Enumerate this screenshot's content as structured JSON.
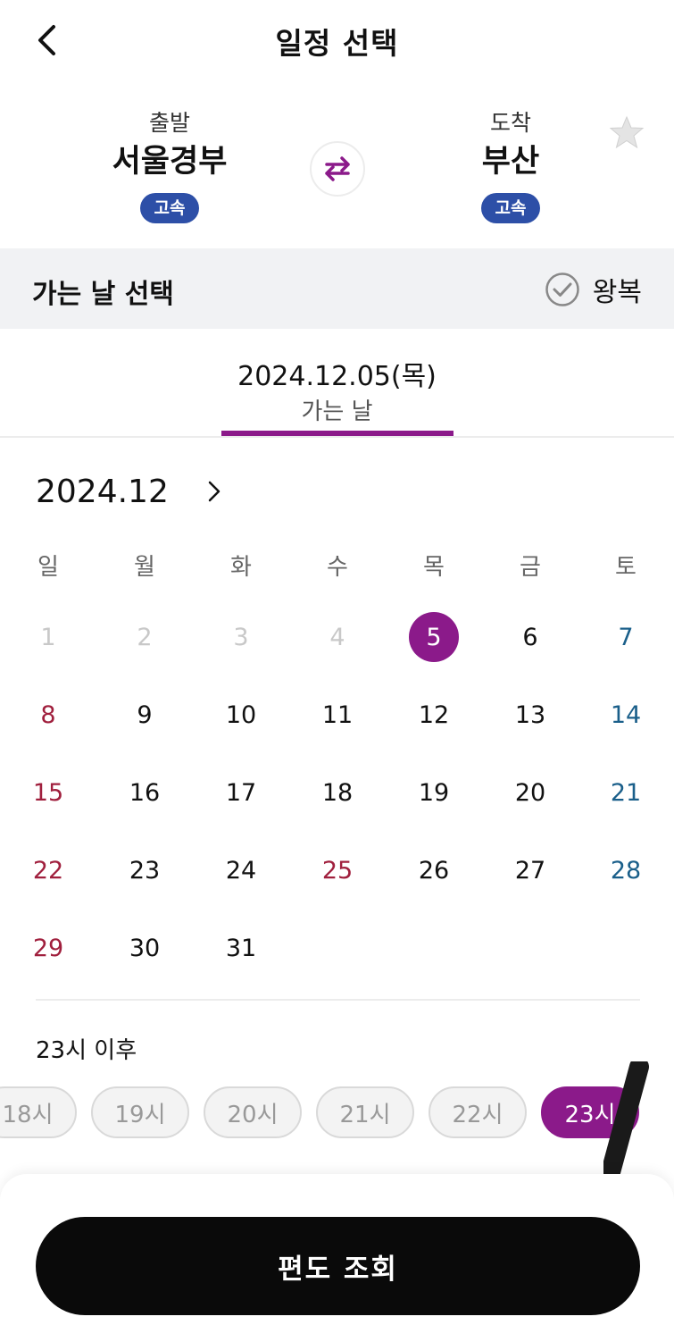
{
  "header": {
    "title": "일정 선택",
    "back_icon": "chevron-left-icon"
  },
  "route": {
    "departure": {
      "label": "출발",
      "name": "서울경부",
      "badge": "고속"
    },
    "arrival": {
      "label": "도착",
      "name": "부산",
      "badge": "고속"
    },
    "swap_icon": "swap-arrows-icon",
    "favorite_icon": "star-icon"
  },
  "day_select": {
    "title": "가는 날 선택",
    "roundtrip_label": "왕복",
    "roundtrip_icon": "check-circle-icon"
  },
  "date_tab": {
    "date": "2024.12.05(목)",
    "label": "가는 날"
  },
  "calendar": {
    "month_label": "2024.12",
    "weekdays": [
      "일",
      "월",
      "화",
      "수",
      "목",
      "금",
      "토"
    ],
    "rows": [
      [
        "1",
        "2",
        "3",
        "4",
        "5",
        "6",
        "7"
      ],
      [
        "8",
        "9",
        "10",
        "11",
        "12",
        "13",
        "14"
      ],
      [
        "15",
        "16",
        "17",
        "18",
        "19",
        "20",
        "21"
      ],
      [
        "22",
        "23",
        "24",
        "25",
        "26",
        "27",
        "28"
      ],
      [
        "29",
        "30",
        "31",
        "",
        "",
        "",
        ""
      ]
    ],
    "selected_day": "5",
    "disabled_days": [
      "1",
      "2",
      "3",
      "4"
    ],
    "holidays": [
      "25"
    ]
  },
  "time": {
    "label": "23시 이후",
    "chips": [
      "18시",
      "19시",
      "20시",
      "21시",
      "22시",
      "23시"
    ],
    "selected": "23시"
  },
  "cta": {
    "label": "편도 조회"
  },
  "colors": {
    "accent": "#8b1a8a",
    "badge": "#2d4fa7",
    "sunday": "#a01f3d",
    "saturday": "#1a5f8a"
  }
}
